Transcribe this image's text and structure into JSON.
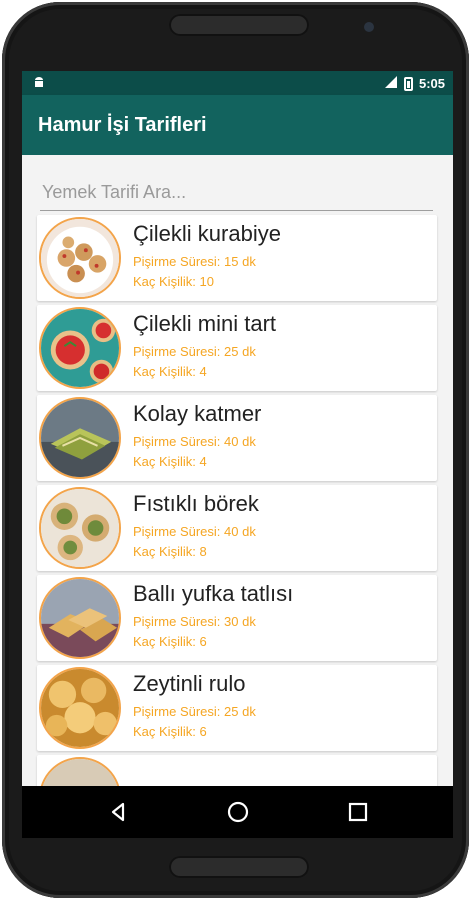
{
  "status_bar": {
    "left_icon": "android-icon",
    "network": "LTE",
    "time": "5:05"
  },
  "app_bar": {
    "title": "Hamur İşi Tarifleri"
  },
  "search": {
    "placeholder": "Yemek Tarifi Ara..."
  },
  "labels": {
    "cook_time": "Pişirme Süresi:",
    "servings": "Kaç Kişilik:"
  },
  "recipes": [
    {
      "name": "Çilekli kurabiye",
      "cook_time": "15 dk",
      "servings": "10"
    },
    {
      "name": "Çilekli mini tart",
      "cook_time": "25 dk",
      "servings": "4"
    },
    {
      "name": "Kolay katmer",
      "cook_time": "40 dk",
      "servings": "4"
    },
    {
      "name": "Fıstıklı börek",
      "cook_time": "40 dk",
      "servings": "8"
    },
    {
      "name": "Ballı yufka tatlısı",
      "cook_time": "30 dk",
      "servings": "6"
    },
    {
      "name": "Zeytinli rulo",
      "cook_time": "25 dk",
      "servings": "6"
    }
  ],
  "colors": {
    "status_bar": "#0c4d49",
    "app_bar": "#12635e",
    "meta_text": "#f5a623",
    "thumb_border": "#f3a44a"
  },
  "nav": {
    "back": "back-icon",
    "home": "home-icon",
    "recents": "recents-icon"
  }
}
